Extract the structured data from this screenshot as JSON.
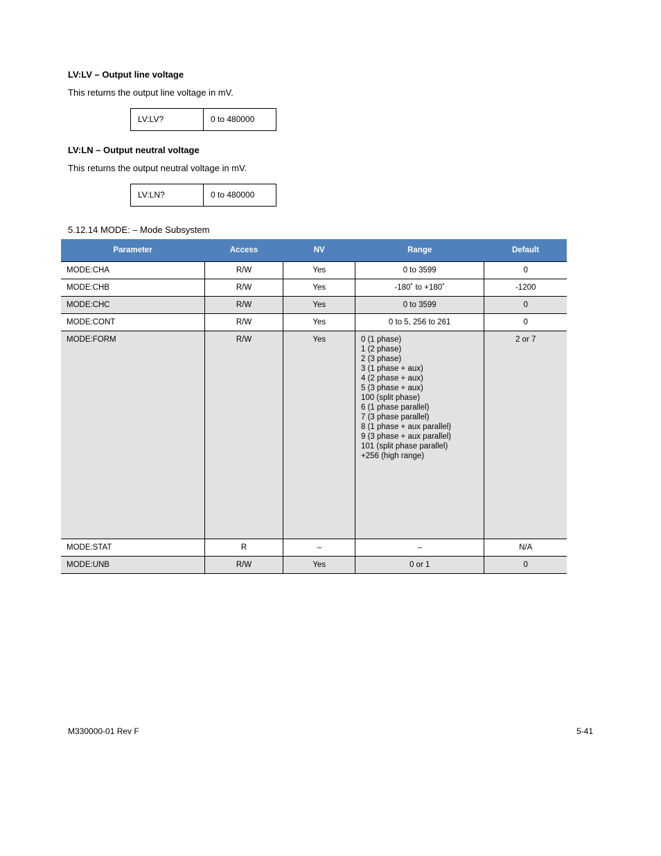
{
  "section_lv_title": "LV:LV – Output line voltage",
  "section_lv_body": "This returns the output line voltage in mV.",
  "section_ln_title": "LV:LN – Output neutral voltage",
  "section_ln_body": "This returns the output neutral voltage in mV.",
  "small_table_1": {
    "c1": "LV:LV?",
    "c2": "0 to 480000"
  },
  "small_table_2": {
    "c1": "LV:LN?",
    "c2": "0 to 480000"
  },
  "main_caption": "5.12.14 MODE: – Mode Subsystem",
  "main_table": {
    "headers": [
      "Parameter",
      "Access",
      "NV",
      "Range",
      "Default"
    ],
    "rows": [
      {
        "param": "MODE:CHA",
        "access": "R/W",
        "nv": "Yes",
        "range": "0 to 3599",
        "default": "0",
        "shade": false
      },
      {
        "param": "MODE:CHB",
        "access": "R/W",
        "nv": "Yes",
        "range": "-180˚ to +180˚",
        "default": "-1200",
        "shade": false
      },
      {
        "param": "MODE:CHC",
        "access": "R/W",
        "nv": "Yes",
        "range": "0 to 3599",
        "default": "0",
        "shade": true
      },
      {
        "param": "MODE:CONT",
        "access": "R/W",
        "nv": "Yes",
        "range": "0 to 5, 256 to 261",
        "default": "0",
        "shade": false
      },
      {
        "param": "MODE:FORM",
        "access": "R/W",
        "nv": "Yes",
        "range_lines": [
          "0 (1 phase)",
          "1 (2 phase)",
          "2 (3 phase)",
          "3 (1 phase + aux)",
          "4 (2 phase + aux)",
          "5 (3 phase + aux)",
          "100 (split phase)",
          "6 (1 phase parallel)",
          "7 (3 phase parallel)",
          "8 (1 phase + aux parallel)",
          "9 (3 phase + aux parallel)",
          "101 (split phase parallel)",
          "+256 (high range)"
        ],
        "default": "2 or 7",
        "shade": true,
        "tall": true
      },
      {
        "param": "MODE:STAT",
        "access": "R",
        "nv": "–",
        "range": "–",
        "default": "N/A",
        "shade": false
      },
      {
        "param": "MODE:UNB",
        "access": "R/W",
        "nv": "Yes",
        "range": "0 or 1",
        "default": "0",
        "shade": true
      }
    ]
  },
  "footer": {
    "left": "M330000-01 Rev F",
    "right": "5-41"
  }
}
